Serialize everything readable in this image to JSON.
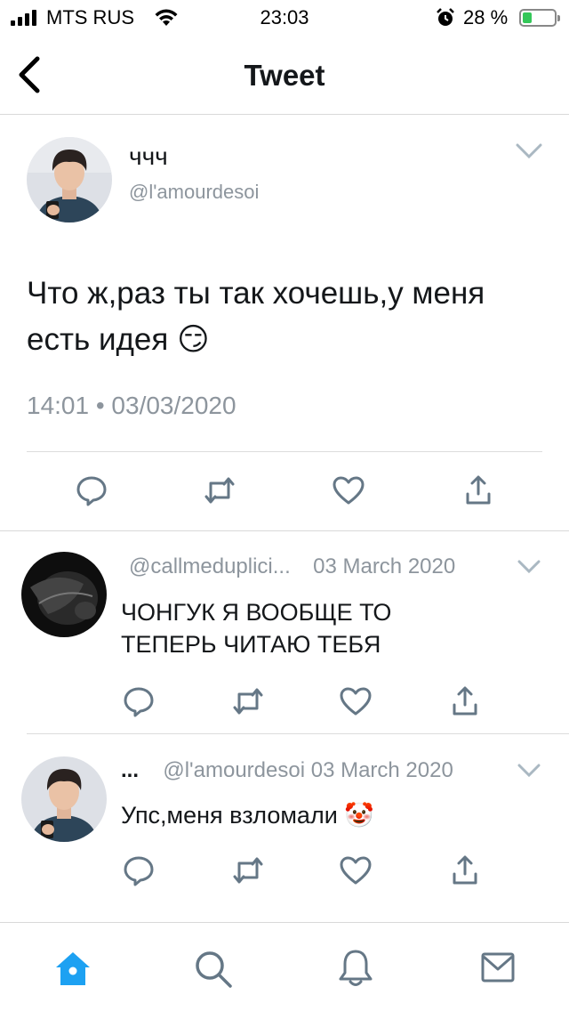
{
  "status_bar": {
    "carrier": "MTS RUS",
    "time": "23:03",
    "battery_percent": "28 %",
    "battery_level": 0.28
  },
  "nav": {
    "title": "Tweet"
  },
  "main_tweet": {
    "display_name": "ччч",
    "handle": "@l'amourdesoi",
    "text": "Что ж,раз ты так хочешь,у меня есть идея 😏",
    "meta": "14:01 • 03/03/2020"
  },
  "replies": [
    {
      "display_name": "",
      "handle": "@callmeduplici...",
      "date": "03 March 2020",
      "text": "ЧОНГУК Я ВООБЩЕ ТО ТЕПЕРЬ ЧИТАЮ ТЕБЯ"
    },
    {
      "display_name": "...",
      "handle": "@l'amourdesoi",
      "date": "03 March 2020",
      "text": "Упс,меня взломали 🤡"
    }
  ],
  "colors": {
    "accent": "#1da1f2",
    "icon_gray": "#657786",
    "muted_text": "#8d959d"
  },
  "tab_bar": {
    "items": [
      "home-icon",
      "search-icon",
      "notifications-icon",
      "messages-icon"
    ],
    "active": "home-icon"
  }
}
